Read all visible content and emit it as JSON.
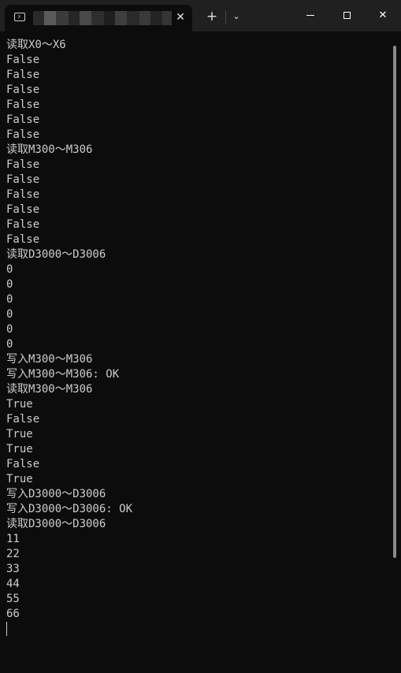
{
  "window": {
    "tab_icon": "terminal-icon",
    "close_tab_label": "✕",
    "new_tab_label": "+",
    "dropdown_label": "⌄",
    "minimize_icon": "minimize-icon",
    "maximize_icon": "maximize-icon",
    "close_label": "✕"
  },
  "console": {
    "lines": [
      "读取X0～X6",
      "False",
      "False",
      "False",
      "False",
      "False",
      "False",
      "读取M300～M306",
      "False",
      "False",
      "False",
      "False",
      "False",
      "False",
      "读取D3000～D3006",
      "0",
      "0",
      "0",
      "0",
      "0",
      "0",
      "写入M300～M306",
      "写入M300～M306: OK",
      "读取M300～M306",
      "True",
      "False",
      "True",
      "True",
      "False",
      "True",
      "写入D3000～D3006",
      "写入D3000～D3006: OK",
      "读取D3000～D3006",
      "11",
      "22",
      "33",
      "44",
      "55",
      "66"
    ]
  },
  "colors": {
    "background": "#0c0c0c",
    "titlebar": "#202020",
    "text": "#cccccc"
  }
}
